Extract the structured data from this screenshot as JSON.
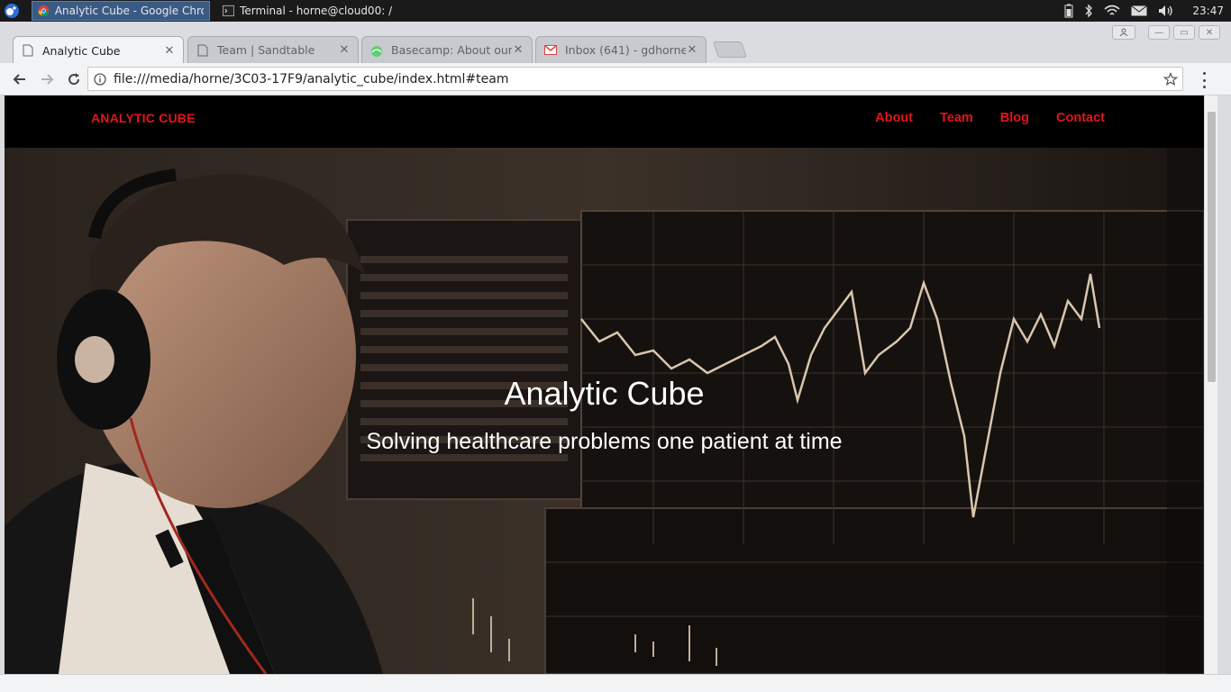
{
  "taskbar": {
    "tasks": [
      {
        "label": "Analytic Cube - Google Chro...",
        "icon": "chrome-icon"
      },
      {
        "label": "Terminal - horne@cloud00: /...",
        "icon": "terminal-icon"
      }
    ],
    "clock": "23:47"
  },
  "browser": {
    "tabs": [
      {
        "title": "Analytic Cube",
        "icon": "page-icon",
        "active": true
      },
      {
        "title": "Team | Sandtable",
        "icon": "page-icon",
        "active": false
      },
      {
        "title": "Basecamp: About our c",
        "icon": "basecamp-icon",
        "active": false
      },
      {
        "title": "Inbox (641) - gdhorne@",
        "icon": "gmail-icon",
        "active": false
      }
    ],
    "url": "file:///media/horne/3C03-17F9/analytic_cube/index.html#team"
  },
  "site": {
    "brand": "ANALYTIC CUBE",
    "nav": [
      "About",
      "Team",
      "Blog",
      "Contact"
    ],
    "brand_color": "#e3141a",
    "hero_title": "Analytic Cube",
    "hero_subtitle": "Solving healthcare problems one patient at time"
  }
}
